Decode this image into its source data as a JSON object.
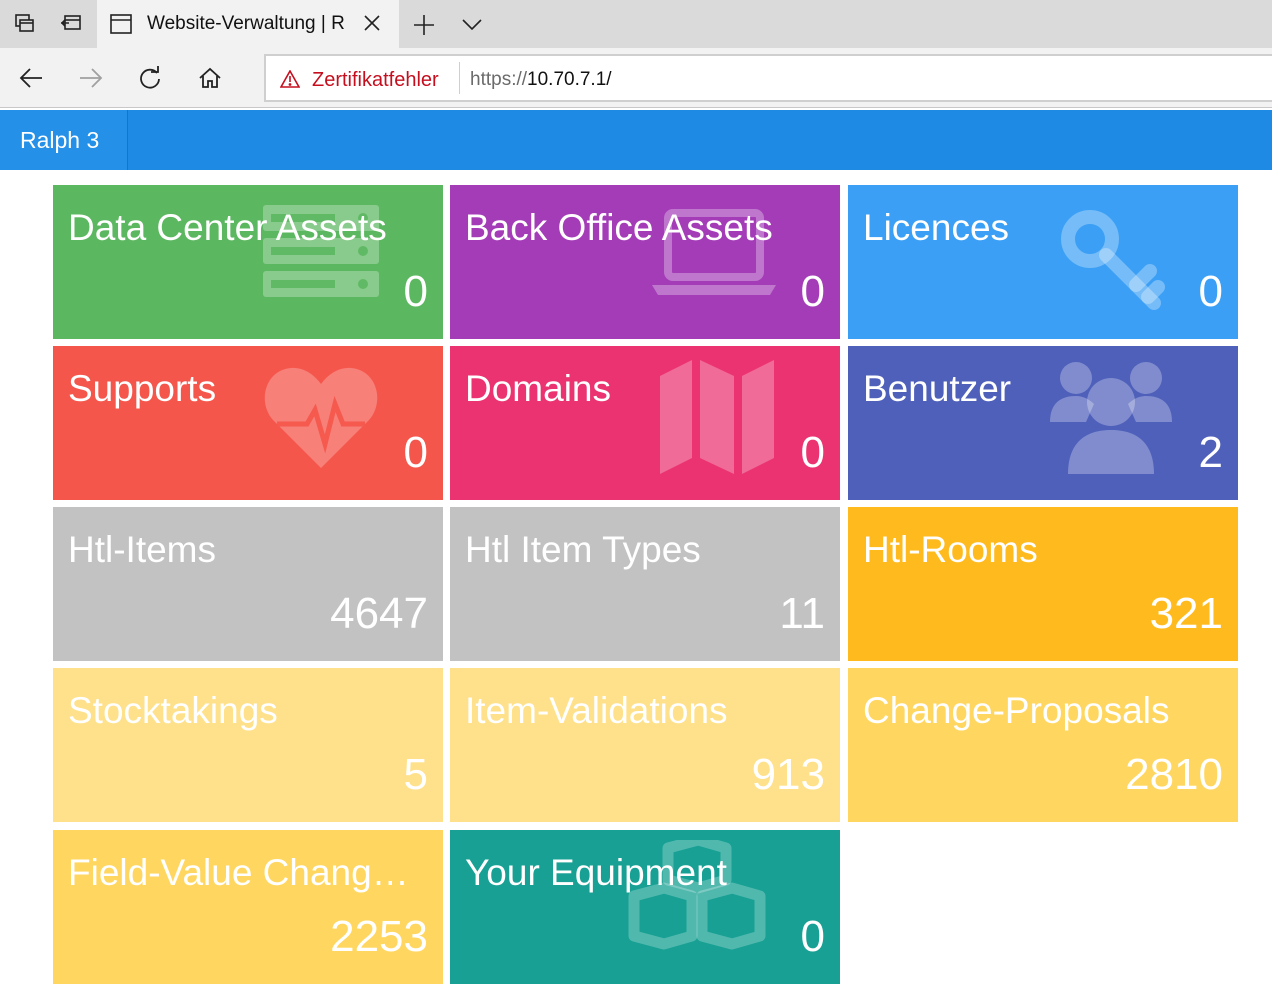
{
  "browser": {
    "tab_title": "Website-Verwaltung | R",
    "address": {
      "cert_error": "Zertifikatfehler",
      "scheme": "https://",
      "host": "10.70.7.1/"
    }
  },
  "app": {
    "brand": "Ralph 3"
  },
  "tiles": [
    {
      "label": "Data Center Assets",
      "count": "0",
      "color": "#5cb860",
      "icon": "server-icon"
    },
    {
      "label": "Back Office Assets",
      "count": "0",
      "color": "#a43cb8",
      "icon": "laptop-icon"
    },
    {
      "label": "Licences",
      "count": "0",
      "color": "#3a9ff5",
      "icon": "key-icon"
    },
    {
      "label": "Supports",
      "count": "0",
      "color": "#f5564c",
      "icon": "heartbeat-icon"
    },
    {
      "label": "Domains",
      "count": "0",
      "color": "#eb3371",
      "icon": "map-icon"
    },
    {
      "label": "Benutzer",
      "count": "2",
      "color": "#4f60bb",
      "icon": "users-icon"
    },
    {
      "label": "Htl-Items",
      "count": "4647",
      "color": "#c2c2c2",
      "icon": ""
    },
    {
      "label": "Htl Item Types",
      "count": "11",
      "color": "#c2c2c2",
      "icon": ""
    },
    {
      "label": "Htl-Rooms",
      "count": "321",
      "color": "#ffbb1e",
      "icon": ""
    },
    {
      "label": "Stocktakings",
      "count": "5",
      "color": "#fee18a",
      "icon": ""
    },
    {
      "label": "Item-Validations",
      "count": "913",
      "color": "#fee18a",
      "icon": ""
    },
    {
      "label": "Change-Proposals",
      "count": "2810",
      "color": "#ffd760",
      "icon": ""
    },
    {
      "label": "Field-Value Chang…",
      "count": "2253",
      "color": "#ffd760",
      "icon": ""
    },
    {
      "label": "Your Equipment",
      "count": "0",
      "color": "#17a093",
      "icon": "cubes-icon"
    }
  ]
}
